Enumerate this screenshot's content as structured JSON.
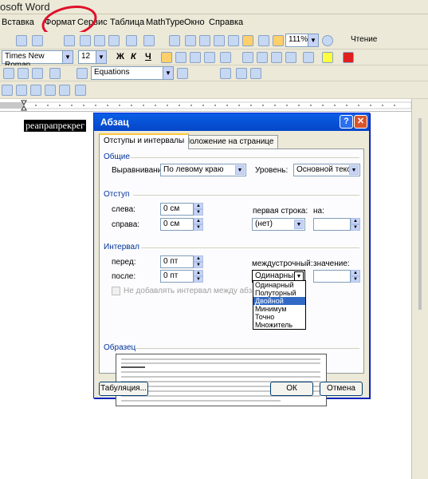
{
  "app": {
    "title": "osoft Word"
  },
  "menu": [
    "Вставка",
    "Формат",
    "Сервис",
    "Таблица",
    "MathType",
    "Окно",
    "Справка"
  ],
  "toolbar1": {
    "zoom": "111%",
    "read_button": "Чтение"
  },
  "toolbar2": {
    "font": "Times New Roman",
    "size": "12",
    "bold": "Ж",
    "italic": "К",
    "underline": "Ч"
  },
  "toolbar3": {
    "equations": "Equations"
  },
  "document": {
    "text": "реапрапрекрег"
  },
  "dialog": {
    "title": "Абзац",
    "help_btn": "?",
    "close_btn": "✕",
    "tabs": [
      "Отступы и интервалы",
      "Положение на странице"
    ],
    "general": {
      "section": "Общие",
      "alignment_label": "Выравнивание:",
      "alignment_value": "По левому краю",
      "level_label": "Уровень:",
      "level_value": "Основной текст"
    },
    "indent": {
      "section": "Отступ",
      "left_label": "слева:",
      "left_value": "0 см",
      "right_label": "справа:",
      "right_value": "0 см",
      "first_line_label": "первая строка:",
      "first_line_value": "(нет)",
      "by_label": "на:"
    },
    "spacing": {
      "section": "Интервал",
      "before_label": "перед:",
      "before_value": "0 пт",
      "after_label": "после:",
      "after_value": "0 пт",
      "line_spacing_label": "междустрочный:",
      "line_spacing_value": "Одинарный",
      "value_label": "значение:",
      "no_space_label": "Не добавлять интервал между абзацами о"
    },
    "line_spacing_options": [
      "Одинарный",
      "Полуторный",
      "Двойной",
      "Минимум",
      "Точно",
      "Множитель"
    ],
    "line_spacing_selected_index": 2,
    "preview": {
      "section": "Образец"
    },
    "buttons": {
      "tabs": "Табуляция...",
      "ok": "ОК",
      "cancel": "Отмена"
    }
  },
  "colors": {
    "accent": "#0a5fe6",
    "annotation": "#e0102a",
    "selection": "#316ac5"
  }
}
